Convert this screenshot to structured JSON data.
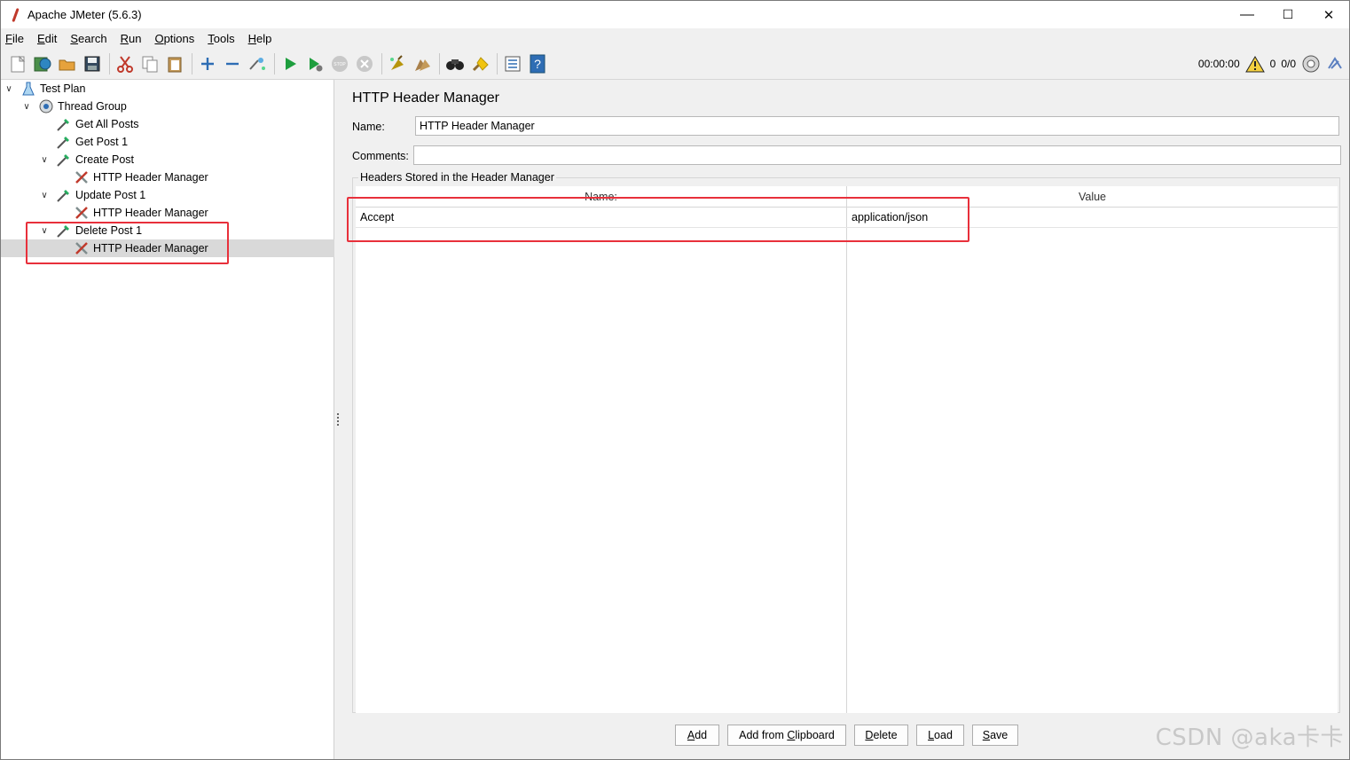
{
  "window": {
    "title": "Apache JMeter (5.6.3)",
    "controls": {
      "minimize": "—",
      "maximize": "☐",
      "close": "✕"
    }
  },
  "menubar": {
    "items": [
      {
        "label": "File",
        "mnemonic": "F",
        "rest": "ile"
      },
      {
        "label": "Edit",
        "mnemonic": "E",
        "rest": "dit"
      },
      {
        "label": "Search",
        "mnemonic": "S",
        "rest": "earch"
      },
      {
        "label": "Run",
        "mnemonic": "R",
        "rest": "un"
      },
      {
        "label": "Options",
        "mnemonic": "O",
        "rest": "ptions"
      },
      {
        "label": "Tools",
        "mnemonic": "T",
        "rest": "ools"
      },
      {
        "label": "Help",
        "mnemonic": "H",
        "rest": "elp"
      }
    ]
  },
  "toolbar": {
    "timer": "00:00:00",
    "warning_count": "0",
    "threads": "0/0",
    "icons": [
      "new-icon",
      "templates-icon",
      "open-icon",
      "save-icon",
      "cut-icon",
      "copy-icon",
      "paste-icon",
      "expand-icon",
      "collapse-icon",
      "toggle-icon",
      "start-icon",
      "start-no-pause-icon",
      "stop-icon",
      "shutdown-icon",
      "clear-icon",
      "clear-all-icon",
      "search-icon",
      "reset-search-icon",
      "function-helper-icon",
      "help-icon"
    ]
  },
  "tree": {
    "nodes": [
      {
        "label": "Test Plan",
        "icon": "test-plan-icon",
        "toggle": "expanded"
      },
      {
        "label": "Thread Group",
        "icon": "thread-group-icon",
        "toggle": "expanded"
      },
      {
        "label": "Get All Posts",
        "icon": "sampler-icon",
        "toggle": ""
      },
      {
        "label": "Get Post 1",
        "icon": "sampler-icon",
        "toggle": ""
      },
      {
        "label": "Create Post",
        "icon": "sampler-icon",
        "toggle": "expanded"
      },
      {
        "label": "HTTP Header Manager",
        "icon": "config-tools-icon",
        "toggle": ""
      },
      {
        "label": "Update Post 1",
        "icon": "sampler-icon",
        "toggle": "expanded"
      },
      {
        "label": "HTTP Header Manager",
        "icon": "config-tools-icon",
        "toggle": ""
      },
      {
        "label": "Delete Post 1",
        "icon": "sampler-icon",
        "toggle": "expanded"
      },
      {
        "label": "HTTP Header Manager",
        "icon": "config-tools-icon",
        "toggle": "",
        "selected": true
      }
    ]
  },
  "main": {
    "title": "HTTP Header Manager",
    "name_label": "Name:",
    "name_value": "HTTP Header Manager",
    "comments_label": "Comments:",
    "comments_value": "",
    "group_title": "Headers Stored in the Header Manager",
    "table": {
      "columns": [
        "Name:",
        "Value"
      ],
      "rows": [
        {
          "name": "Accept",
          "value": "application/json"
        }
      ]
    },
    "buttons": [
      {
        "label": "Add",
        "mnemonic": "A",
        "rest": "dd"
      },
      {
        "label": "Add from Clipboard",
        "pre": "Add from ",
        "mnemonic": "C",
        "rest": "lipboard"
      },
      {
        "label": "Delete",
        "mnemonic": "D",
        "rest": "elete"
      },
      {
        "label": "Load",
        "mnemonic": "L",
        "rest": "oad"
      },
      {
        "label": "Save",
        "mnemonic": "S",
        "rest": "ave"
      }
    ]
  },
  "colors": {
    "highlight_box": "#e8303b",
    "selected_row": "#d9d9d9"
  },
  "watermark": "CSDN @aka卡卡"
}
